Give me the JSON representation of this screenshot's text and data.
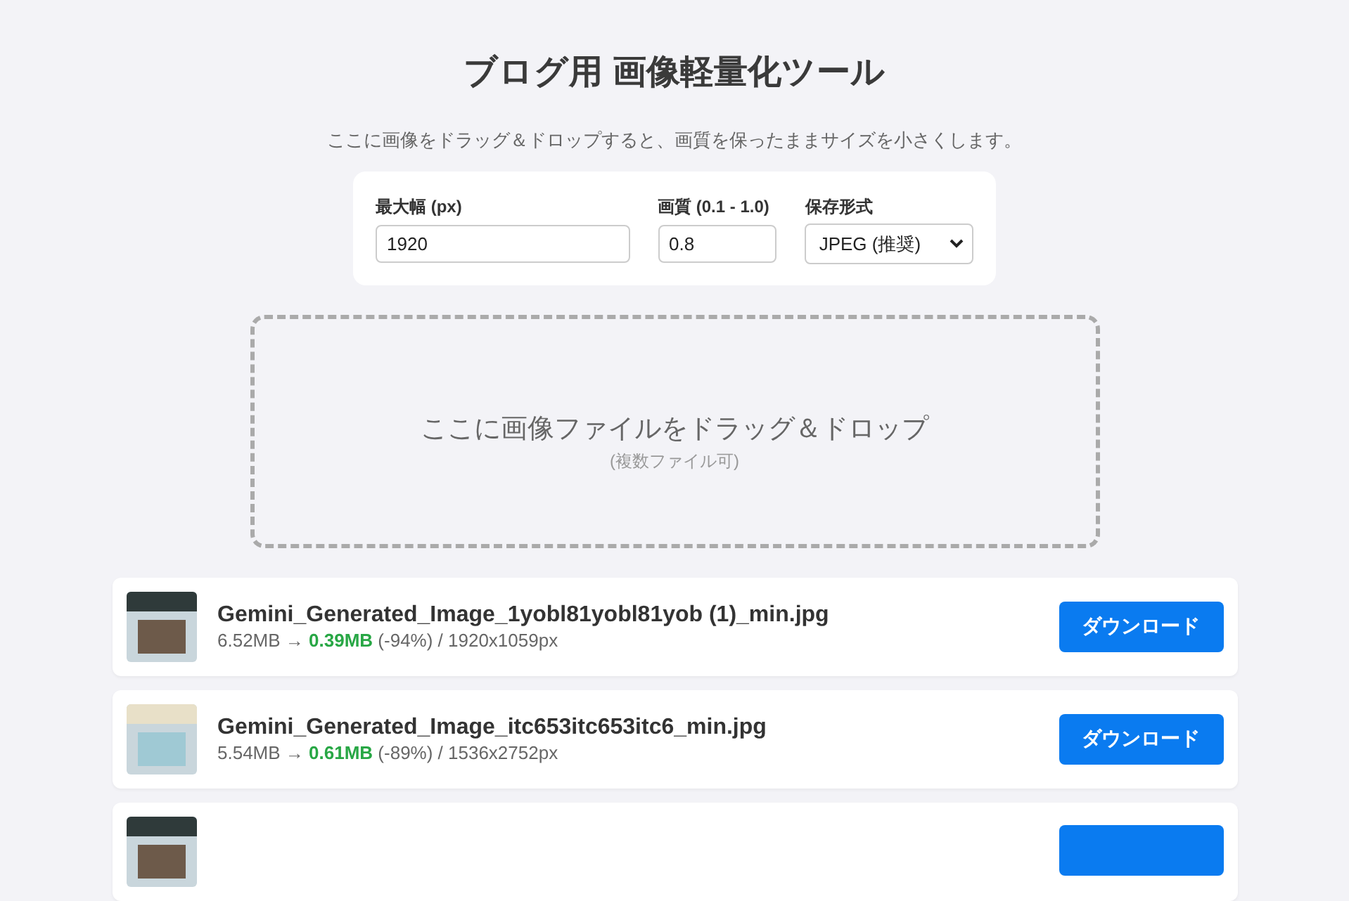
{
  "title": "ブログ用 画像軽量化ツール",
  "subtitle": "ここに画像をドラッグ＆ドロップすると、画質を保ったままサイズを小さくします。",
  "settings": [
    {
      "kind": "text",
      "label": "最大幅 (px)",
      "value": "1920"
    },
    {
      "kind": "text",
      "label": "画質 (0.1 - 1.0)",
      "value": "0.8"
    },
    {
      "kind": "select",
      "label": "保存形式",
      "value": "JPEG (推奨)"
    }
  ],
  "dropzone": {
    "text": "ここに画像ファイルをドラッグ＆ドロップ",
    "note": "(複数ファイル可)"
  },
  "results": [
    {
      "kind": "full",
      "name": "Gemini_Generated_Image_1yobl81yobl81yob (1)_min.jpg",
      "before": "6.52MB →",
      "after": "0.39MB",
      "rest": "(-94%) / 1920x1059px",
      "button": "ダウンロード"
    },
    {
      "kind": "full",
      "name": "Gemini_Generated_Image_itc653itc653itc6_min.jpg",
      "before": "5.54MB →",
      "after": "0.61MB",
      "rest": "(-89%) / 1536x2752px",
      "button": "ダウンロード"
    },
    {
      "kind": "cut"
    }
  ]
}
